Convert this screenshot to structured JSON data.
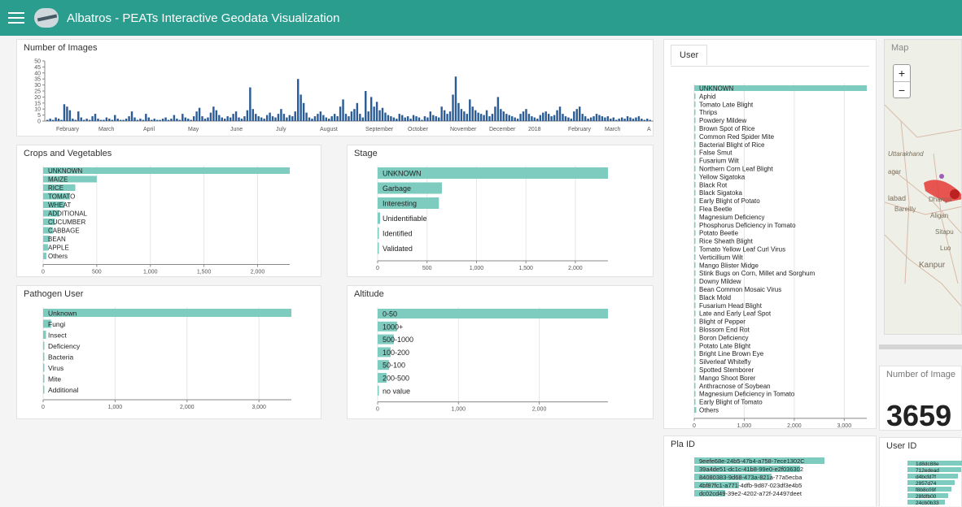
{
  "app": {
    "title": "Albatros - PEATs Interactive Geodata Visualization"
  },
  "colors": {
    "topbar": "#2a9d8f",
    "bar": "#7ecbbf",
    "timeline": "#2b5c95"
  },
  "timeline": {
    "title": "Number of Images",
    "y_ticks": [
      "50",
      "45",
      "40",
      "35",
      "30",
      "25",
      "20",
      "15",
      "10",
      "5",
      "0"
    ],
    "x_ticks": [
      "February",
      "March",
      "April",
      "May",
      "June",
      "July",
      "August",
      "September",
      "October",
      "November",
      "December",
      "2018",
      "February",
      "March",
      "A"
    ]
  },
  "crops": {
    "title": "Crops and Vegetables",
    "x_ticks": [
      "0",
      "500",
      "1,000",
      "1,500",
      "2,000"
    ]
  },
  "stage": {
    "title": "Stage",
    "x_ticks": [
      "0",
      "500",
      "1,000",
      "1,500",
      "2,000"
    ]
  },
  "pathogen": {
    "title": "Pathogen User",
    "x_ticks": [
      "0",
      "1,000",
      "2,000",
      "3,000"
    ]
  },
  "altitude": {
    "title": "Altitude",
    "x_ticks": [
      "0",
      "1,000",
      "2,000"
    ]
  },
  "user_panel": {
    "tab": "User",
    "x_ticks": [
      "0",
      "1,000",
      "2,000",
      "3,000"
    ]
  },
  "map": {
    "title": "Map",
    "zoom_in": "+",
    "zoom_out": "−",
    "places": [
      "Uttarakhand",
      "agar",
      "labad",
      "Dhanga",
      "Bareilly",
      "Aligan",
      "Sitapu",
      "Luo",
      "Kanpur"
    ]
  },
  "image_count": {
    "title": "Number of Image",
    "value": "3659"
  },
  "pla_id": {
    "title": "Pla ID",
    "items": [
      "9eefe68e-24b5-47b4-a758-7ece1302C",
      "39a4de51-dc1c-41b8-99e0-e2f036302",
      "84080383-9d68-473a-821a-77a5ecba",
      "4bf87fc1-a771-4dfb-9d87-023df3e4b5",
      "dc02cd49-39e2-4202-a72f-24497deet"
    ]
  },
  "user_id": {
    "title": "User ID",
    "items": [
      "1d8dc88e",
      "712edead",
      "d4bcfd7f",
      "2957d74",
      "f8b8c09f",
      "28fdfb00",
      "24cb0b33"
    ]
  },
  "chart_data": [
    {
      "type": "bar",
      "title": "Number of Images",
      "series_note": "daily image counts",
      "ylim": [
        0,
        50
      ],
      "values": [
        1,
        2,
        1,
        3,
        2,
        1,
        14,
        12,
        9,
        2,
        1,
        8,
        3,
        1,
        2,
        1,
        4,
        6,
        2,
        1,
        1,
        3,
        2,
        1,
        5,
        2,
        1,
        1,
        2,
        4,
        8,
        3,
        1,
        2,
        1,
        6,
        3,
        1,
        2,
        1,
        1,
        2,
        3,
        1,
        2,
        5,
        2,
        1,
        6,
        3,
        2,
        1,
        4,
        8,
        11,
        4,
        2,
        3,
        7,
        12,
        9,
        5,
        3,
        2,
        4,
        3,
        6,
        8,
        3,
        2,
        4,
        9,
        28,
        10,
        6,
        4,
        3,
        2,
        5,
        7,
        4,
        3,
        6,
        10,
        6,
        3,
        5,
        4,
        8,
        35,
        22,
        15,
        7,
        3,
        2,
        4,
        6,
        8,
        5,
        3,
        2,
        4,
        6,
        4,
        12,
        18,
        6,
        4,
        8,
        10,
        15,
        6,
        3,
        25,
        8,
        20,
        12,
        16,
        9,
        11,
        7,
        5,
        4,
        3,
        2,
        6,
        5,
        3,
        4,
        2,
        5,
        4,
        3,
        1,
        4,
        3,
        8,
        5,
        4,
        3,
        12,
        9,
        6,
        8,
        22,
        37,
        15,
        10,
        8,
        6,
        18,
        12,
        9,
        7,
        6,
        5,
        9,
        4,
        6,
        12,
        20,
        10,
        8,
        6,
        5,
        4,
        3,
        2,
        6,
        8,
        10,
        6,
        4,
        3,
        2,
        5,
        7,
        8,
        6,
        4,
        5,
        9,
        12,
        6,
        4,
        3,
        2,
        8,
        10,
        12,
        6,
        4,
        2,
        3,
        4,
        6,
        5,
        4,
        3,
        4,
        2,
        3,
        1,
        2,
        3,
        2,
        4,
        3,
        2,
        3,
        4,
        2,
        1,
        2,
        1
      ]
    },
    {
      "type": "bar",
      "title": "Crops and Vegetables",
      "categories": [
        "UNKNOWN",
        "MAIZE",
        "RICE",
        "TOMATO",
        "WHEAT",
        "ADDITIONAL",
        "CUCUMBER",
        "CABBAGE",
        "BEAN",
        "APPLE",
        "Others"
      ],
      "values": [
        2300,
        500,
        300,
        250,
        200,
        150,
        110,
        90,
        60,
        45,
        30
      ],
      "xlim": [
        0,
        2300
      ]
    },
    {
      "type": "bar",
      "title": "Stage",
      "categories": [
        "UNKNOWN",
        "Garbage",
        "Interesting",
        "Unidentifiable",
        "Identified",
        "Validated"
      ],
      "values": [
        2330,
        650,
        620,
        25,
        10,
        5
      ],
      "xlim": [
        0,
        2330
      ]
    },
    {
      "type": "bar",
      "title": "Pathogen User",
      "categories": [
        "Unknown",
        "Fungi",
        "Insect",
        "Deficiency",
        "Bacteria",
        "Virus",
        "Mite",
        "Additional"
      ],
      "values": [
        3450,
        110,
        40,
        15,
        8,
        5,
        3,
        2
      ],
      "xlim": [
        0,
        3450
      ]
    },
    {
      "type": "bar",
      "title": "Altitude",
      "categories": [
        "0-50",
        "1000+",
        "500-1000",
        "100-200",
        "50-100",
        "200-500",
        "no value"
      ],
      "values": [
        2850,
        240,
        200,
        160,
        140,
        110,
        0
      ],
      "xlim": [
        0,
        2850
      ]
    },
    {
      "type": "bar",
      "title": "User",
      "categories": [
        "UNKNOWN",
        "Aphid",
        "Tomato Late Blight",
        "Thrips",
        "Powdery Mildew",
        "Brown Spot of Rice",
        "Common Red Spider Mite",
        "Bacterial Blight of Rice",
        "False Smut",
        "Fusarium Wilt",
        "Northern Corn Leaf Blight",
        "Yellow Sigatoka",
        "Black Rot",
        "Black Sigatoka",
        "Early Blight of Potato",
        "Flea Beetle",
        "Magnesium Deficiency",
        "Phosphorus Deficiency in Tomato",
        "Potato Beetle",
        "Rice Sheath Blight",
        "Tomato Yellow Leaf Curl Virus",
        "Verticillium Wilt",
        "Mango Blister Midge",
        "Stink Bugs on Corn, Millet and Sorghum",
        "Downy Mildew",
        "Bean Common Mosaic Virus",
        "Black Mold",
        "Fusarium Head Blight",
        "Late and Early Leaf Spot",
        "Blight of Pepper",
        "Blossom End Rot",
        "Boron Deficiency",
        "Potato Late Blight",
        "Bright Line Brown Eye",
        "Silverleaf Whitefly",
        "Spotted Stemborer",
        "Mango Shoot Borer",
        "Anthracnose of Soybean",
        "Magnesium Deficiency in Tomato",
        "Early Blight of Tomato",
        "Others"
      ],
      "values": [
        3450,
        20,
        18,
        16,
        15,
        14,
        13,
        12,
        11,
        11,
        10,
        10,
        9,
        9,
        9,
        8,
        8,
        8,
        7,
        7,
        7,
        7,
        6,
        6,
        6,
        6,
        5,
        5,
        5,
        5,
        5,
        4,
        4,
        4,
        4,
        4,
        3,
        3,
        3,
        3,
        40
      ],
      "xlim": [
        0,
        3450
      ]
    }
  ]
}
